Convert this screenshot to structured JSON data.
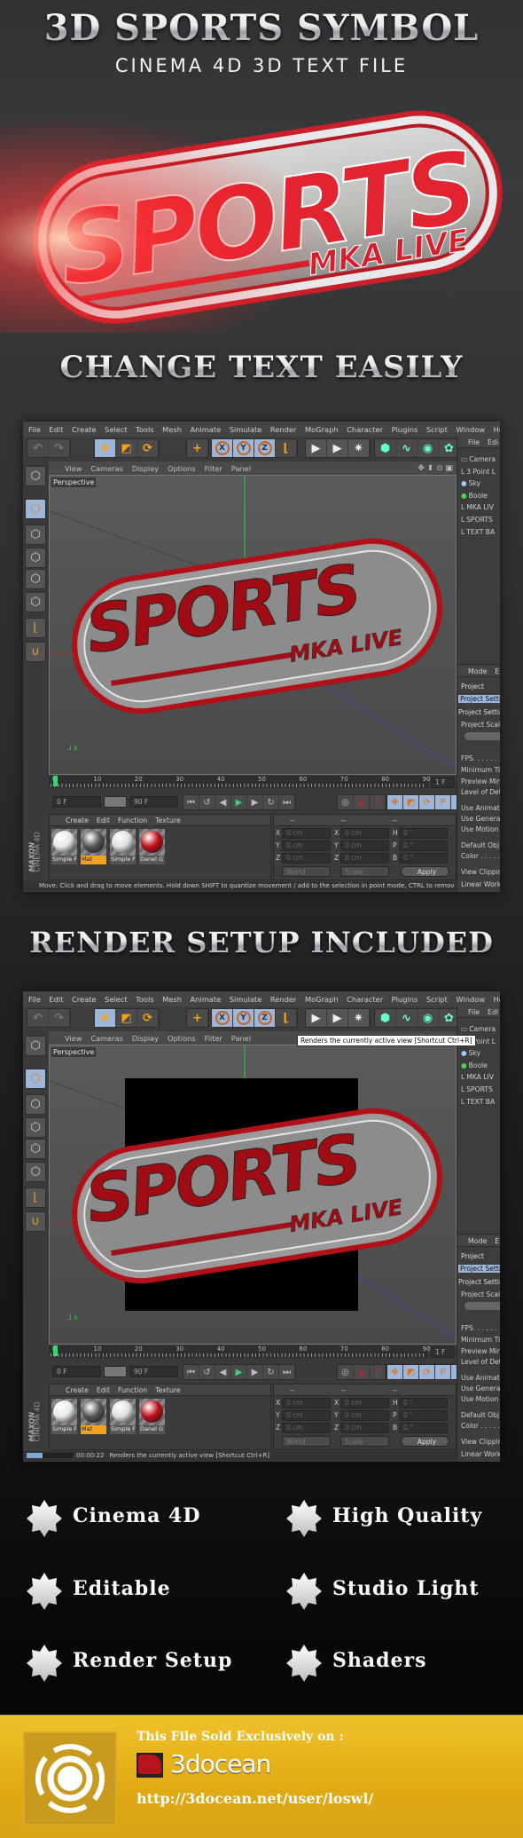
{
  "header": {
    "title": "3D SPORTS SYMBOL",
    "subtitle": "CINEMA 4D 3D TEXT FILE",
    "section1": "CHANGE TEXT EASILY",
    "section2": "RENDER SETUP INCLUDED"
  },
  "logo": {
    "main": "SPORTS",
    "sub": "MKA LIVE"
  },
  "c4d": {
    "menu": [
      "File",
      "Edit",
      "Create",
      "Select",
      "Tools",
      "Mesh",
      "Animate",
      "Simulate",
      "Render",
      "MoGraph",
      "Character",
      "Plugins",
      "Script",
      "Window",
      "Help"
    ],
    "axes": [
      "X",
      "Y",
      "Z"
    ],
    "toolbar_icons": [
      "undo-icon",
      "redo-icon",
      "select-icon",
      "move-icon",
      "scale-icon",
      "rotate-icon",
      "add-icon",
      "x-axis-icon",
      "y-axis-icon",
      "z-axis-icon",
      "coordinate-system-icon",
      "render-view-icon",
      "render-picture-viewer-icon",
      "render-settings-icon",
      "cube-icon",
      "spline-icon",
      "nurbs-icon",
      "mograph-cloner-icon"
    ],
    "viewport_menu": [
      "View",
      "Cameras",
      "Display",
      "Options",
      "Filter",
      "Panel"
    ],
    "viewport_label": "Perspective",
    "timeline_ticks": [
      "0",
      "10",
      "20",
      "30",
      "40",
      "50",
      "60",
      "70",
      "80",
      "90"
    ],
    "current_frame": "1 F",
    "start_frame": "0 F",
    "end_frame": "90 F",
    "material_menu": [
      "Create",
      "Edit",
      "Function",
      "Texture"
    ],
    "materials": [
      {
        "name": "Simple F",
        "color": "#e8e8e8"
      },
      {
        "name": "Mat",
        "color": "#555555",
        "selected": true
      },
      {
        "name": "Simple F",
        "color": "#e0e0e0"
      },
      {
        "name": "Danel G",
        "color": "#c0101a"
      }
    ],
    "coord_headers": [
      "--",
      "--",
      "--"
    ],
    "coord_rows": [
      {
        "a": "X",
        "av": "0 cm",
        "b": "X",
        "bv": "0 cm",
        "c": "H",
        "cv": "0 °"
      },
      {
        "a": "Y",
        "av": "0 cm",
        "b": "Y",
        "bv": "0 cm",
        "c": "P",
        "cv": "0 °"
      },
      {
        "a": "Z",
        "av": "0 cm",
        "b": "Z",
        "bv": "0 cm",
        "c": "B",
        "cv": "0 °"
      }
    ],
    "coord_world": "World",
    "coord_scale": "Scale",
    "apply": "Apply",
    "brand_maxon": "MAXON",
    "brand_cinema": "CINEMA 4D",
    "object_menu": [
      "File",
      "Edi"
    ],
    "objects": [
      "Camera",
      "3 Point L",
      "Sky",
      "Boole",
      "MKA LIV",
      "SPORTS",
      "TEXT BA"
    ],
    "attr_menu": [
      "Mode",
      "E"
    ],
    "attrs": {
      "project": "Project",
      "tab": "Project Settin",
      "section": "Project Setting",
      "scale": "Project Scale",
      "rows": [
        "FPS. . . . . . .",
        "Minimum Tin",
        "Preview Min",
        "Level of Det",
        "Use Animati",
        "Use Generat",
        "Use Motion",
        "Default Obj",
        "Color . . . . .",
        "View Clippin",
        "Linear Work"
      ]
    }
  },
  "windows": [
    {
      "status": "Move: Click and drag to move elements. Hold down SHIFT to quantize movement / add to the selection in point mode, CTRL to remov"
    },
    {
      "status": "Renders the currently active view [Shortcut Ctrl+R]",
      "render_time": "00:00:22",
      "render_progress": 0.35,
      "tooltip": "Renders the currently active view [Shortcut Ctrl+R]"
    }
  ],
  "features": [
    "Cinema 4D",
    "High Quality",
    "Editable",
    "Studio Light",
    "Render Setup",
    "Shaders"
  ],
  "footer": {
    "sold_text": "This File Sold Exclusively on :",
    "brand": "3docean",
    "url": "http://3docean.net/user/loswl/"
  },
  "colors": {
    "accent_red": "#d81e2a",
    "c4d_highlight": "#9db6dc",
    "c4d_orange": "#f2a21c",
    "footer_gold": "#e4b01c"
  }
}
